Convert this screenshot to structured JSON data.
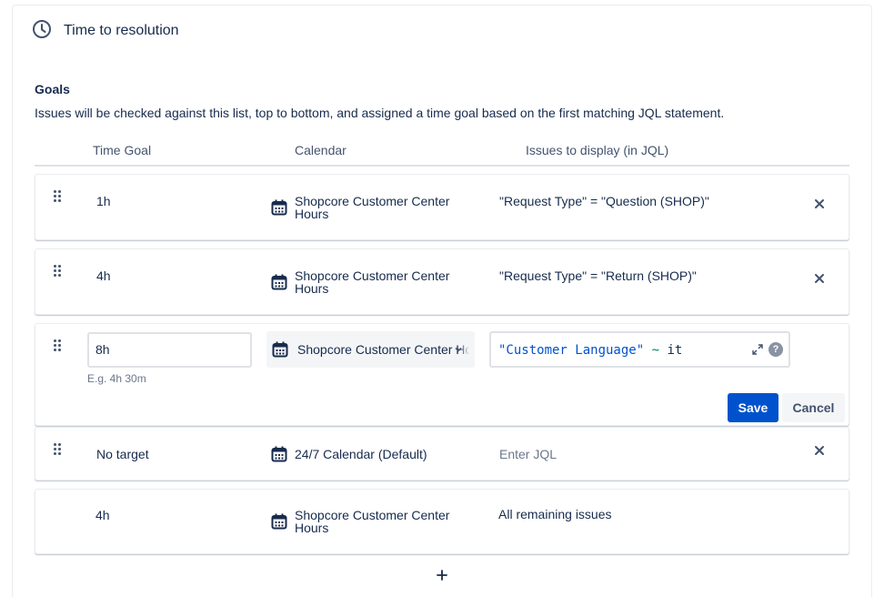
{
  "section": {
    "title": "Time to resolution",
    "icon": "clock-icon"
  },
  "goals": {
    "heading": "Goals",
    "description": "Issues will be checked against this list, top to bottom, and assigned a time goal based on the first matching JQL statement."
  },
  "columns": {
    "time_goal": "Time Goal",
    "calendar": "Calendar",
    "issues": "Issues to display (in JQL)"
  },
  "rows": [
    {
      "time_goal": "1h",
      "calendar_line1": "Shopcore Customer Center",
      "calendar_line2": "Hours",
      "jql": "\"Request Type\" = \"Question (SHOP)\""
    },
    {
      "time_goal": "4h",
      "calendar_line1": "Shopcore Customer Center",
      "calendar_line2": "Hours",
      "jql": "\"Request Type\" = \"Return (SHOP)\""
    }
  ],
  "editing_row": {
    "time_goal_value": "8h",
    "time_goal_hint": "E.g. 4h 30m",
    "calendar_value": "Shopcore Customer Center Hours",
    "jql_field": "\"Customer Language\"",
    "jql_operator": "~",
    "jql_value": "it",
    "help_glyph": "?",
    "save_label": "Save",
    "cancel_label": "Cancel"
  },
  "no_target_row": {
    "time_goal": "No target",
    "calendar": "24/7 Calendar (Default)",
    "jql_placeholder": "Enter JQL"
  },
  "remaining_row": {
    "time_goal": "4h",
    "calendar_line1": "Shopcore Customer Center",
    "calendar_line2": "Hours",
    "jql": "All remaining issues"
  },
  "colors": {
    "primary": "#0052cc",
    "text": "#172b4d",
    "subtle": "#6b778c",
    "jql_keyword": "#0052cc",
    "jql_operator": "#00875a"
  }
}
